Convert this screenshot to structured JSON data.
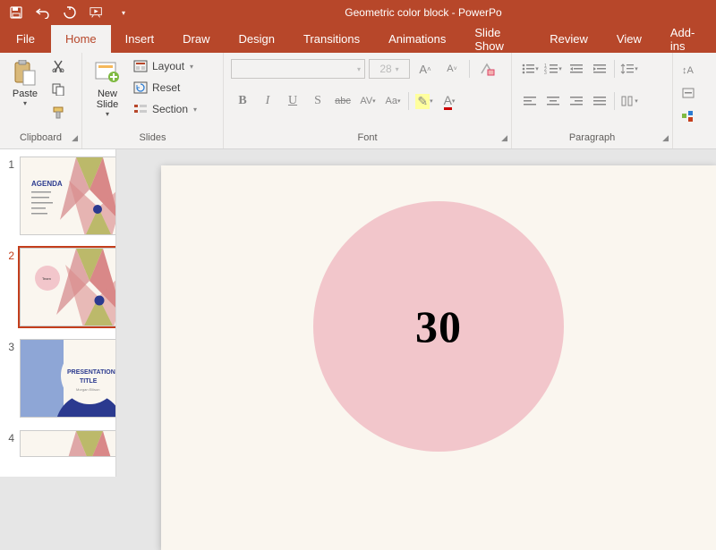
{
  "window": {
    "title": "Geometric color block  -  PowerPo"
  },
  "qat": {
    "save": "save-icon",
    "undo": "undo-icon",
    "redo": "redo-icon",
    "startfrombeginning": "slideshow-icon",
    "customize": "▾"
  },
  "tabs": {
    "file": "File",
    "home": "Home",
    "insert": "Insert",
    "draw": "Draw",
    "design": "Design",
    "transitions": "Transitions",
    "animations": "Animations",
    "slideshow": "Slide Show",
    "review": "Review",
    "view": "View",
    "addins": "Add-ins"
  },
  "ribbon": {
    "clipboard": {
      "label": "Clipboard",
      "paste": "Paste"
    },
    "slides": {
      "label": "Slides",
      "new_slide": "New\nSlide",
      "layout": "Layout",
      "reset": "Reset",
      "section": "Section"
    },
    "font": {
      "label": "Font",
      "size_value": "28",
      "bold": "B",
      "italic": "I",
      "underline": "U",
      "strike": "S",
      "shadow": "abc",
      "spacing": "AV",
      "changecase": "Aa",
      "highlight_glyph": "✎",
      "fontcolor": "A"
    },
    "paragraph": {
      "label": "Paragraph"
    }
  },
  "thumbs": {
    "items": [
      {
        "n": "1",
        "title": "AGENDA"
      },
      {
        "n": "2",
        "title": "Team"
      },
      {
        "n": "3",
        "title": "PRESENTATION TITLE"
      },
      {
        "n": "4",
        "title": ""
      }
    ],
    "selected_index": 1
  },
  "canvas": {
    "circle_value": "30"
  }
}
